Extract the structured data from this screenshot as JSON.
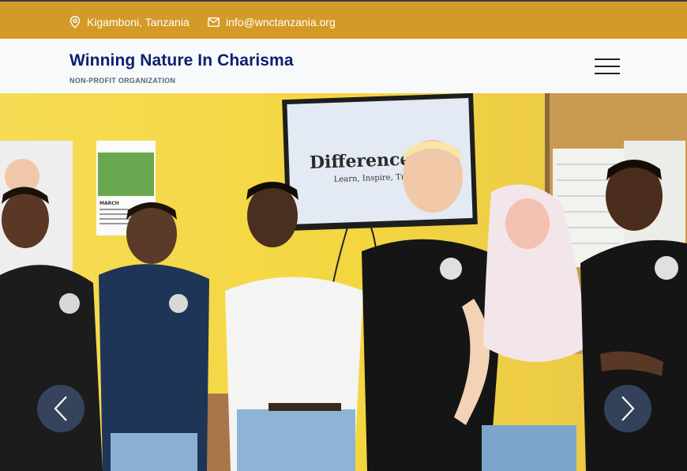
{
  "topbar": {
    "location": "Kigamboni, Tanzania",
    "email": "info@wnctanzania.org"
  },
  "header": {
    "title": "Winning Nature In Charisma",
    "subtitle": "NON-PROFIT ORGANIZATION"
  },
  "hero": {
    "screen_title": "Difference is V",
    "screen_subtitle": "Learn, Inspire, Transf",
    "calendar_month": "MARCH"
  },
  "colors": {
    "topbar": "#d49a27",
    "brand": "#0b1f6e",
    "arrow": "#3c506e"
  },
  "icons": {
    "location": "map-pin-icon",
    "email": "envelope-icon",
    "menu": "hamburger-icon",
    "prev": "chevron-left-icon",
    "next": "chevron-right-icon"
  }
}
